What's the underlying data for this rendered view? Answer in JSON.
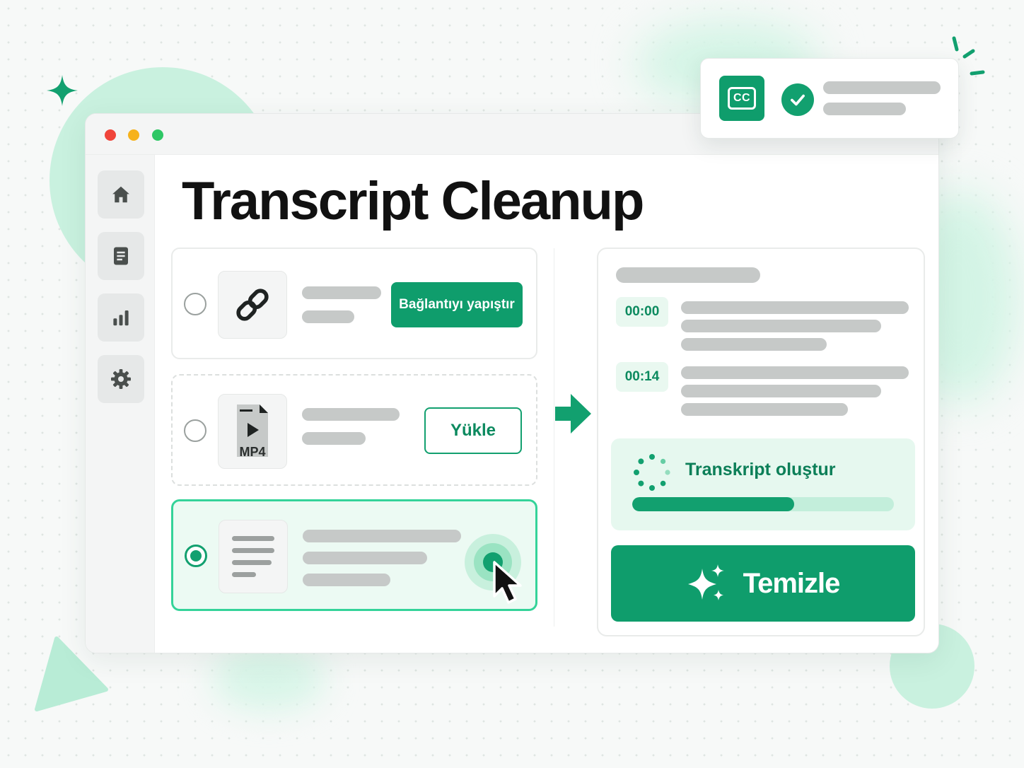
{
  "app": {
    "title": "Transcript Cleanup"
  },
  "sidebar": {
    "items": [
      {
        "icon": "home-icon"
      },
      {
        "icon": "document-icon"
      },
      {
        "icon": "chart-icon"
      },
      {
        "icon": "gear-icon"
      }
    ]
  },
  "sources": {
    "link": {
      "icon": "link-icon",
      "button_label": "Bağlantıyı yapıştır",
      "selected": false
    },
    "file": {
      "icon": "video-file-icon",
      "file_type_label": "MP4",
      "button_label": "Yükle",
      "selected": false
    },
    "text": {
      "icon": "text-lines-icon",
      "selected": true
    }
  },
  "transcript": {
    "timestamps": [
      "00:00",
      "00:14"
    ],
    "progress": {
      "label": "Transkript oluştur",
      "fraction": 0.62
    },
    "clean_button_label": "Temizle"
  },
  "notification": {
    "badge_label": "CC",
    "status": "success"
  },
  "colors": {
    "accent": "#0f9d6c",
    "accent_light": "#e6f8ef",
    "placeholder_bar": "#c6c9c8"
  }
}
